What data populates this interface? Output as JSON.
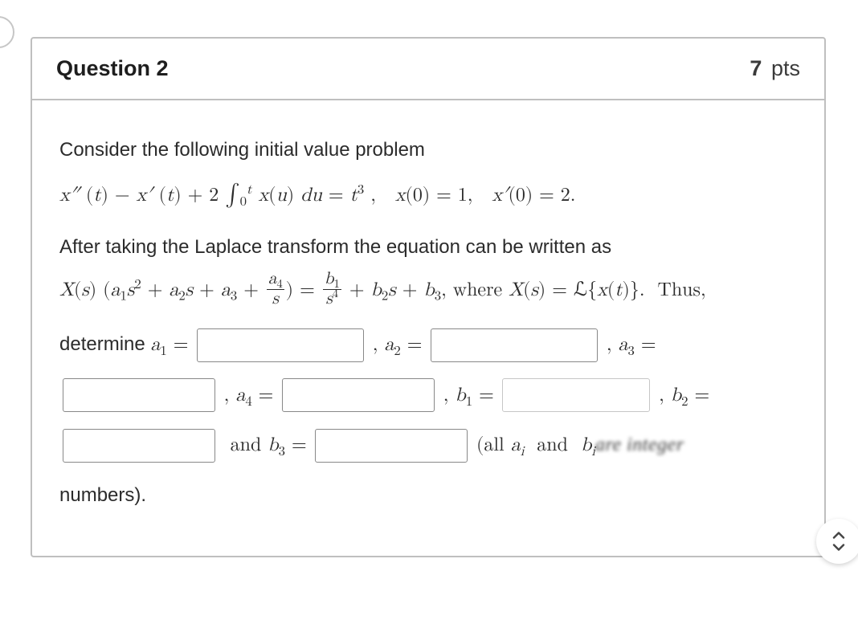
{
  "header": {
    "title": "Question 2",
    "points_num": "7",
    "points_unit": "pts"
  },
  "body": {
    "intro": "Consider the following initial value problem",
    "equation_line": "x″ (t) − x′ (t) + 2 ∫0t x(u) du = t³ ,   x(0) = 1,   x′(0) = 2.",
    "after_line": "After taking the Laplace transform the equation can be written as",
    "transform_line": "X(s) (a₁s² + a₂s + a₃ + a₄/s) = b₁/s⁴ + b₂s + b₃, where X(s) = ℒ{x(t)}.  Thus,",
    "labels": {
      "determine": "determine ",
      "a1": "a₁ = ",
      "a2": ", a₂ = ",
      "a3": ", a₃ = ",
      "a4": ", a₄ = ",
      "b1": ", b₁ = ",
      "b2": ", b₂ = ",
      "and_b3": " and b₃ = ",
      "tail_open": " (all ",
      "tail_ai": "aᵢ",
      "tail_and": " and ",
      "tail_bi": "bᵢ",
      "tail_blur": "are integer",
      "numbers": "numbers)."
    }
  }
}
